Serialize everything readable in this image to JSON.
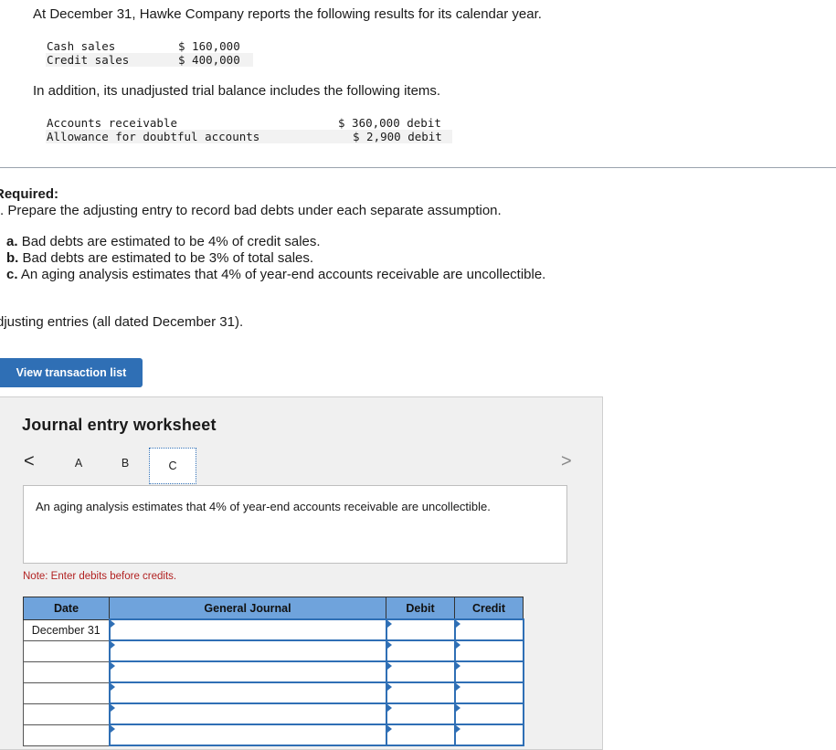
{
  "intro": "At December 31, Hawke Company reports the following results for its calendar year.",
  "sales": [
    {
      "label": "Cash sales",
      "value": "$ 160,000"
    },
    {
      "label": "Credit sales",
      "value": "$ 400,000"
    }
  ],
  "addition_text": "In addition, its unadjusted trial balance includes the following items.",
  "trial_balance": [
    {
      "label": "Accounts receivable",
      "value": "$ 360,000 debit"
    },
    {
      "label": "Allowance for doubtful accounts",
      "value": "$ 2,900 debit"
    }
  ],
  "required_heading": "Required:",
  "required_text": ". Prepare the adjusting entry to record bad debts under each separate assumption.",
  "parts": [
    {
      "letter": "a.",
      "text": "Bad debts are estimated to be 4% of credit sales."
    },
    {
      "letter": "b.",
      "text": "Bad debts are estimated to be 3% of total sales."
    },
    {
      "letter": "c.",
      "text": "An aging analysis estimates that 4% of year-end accounts receivable are uncollectible."
    }
  ],
  "adjusting_text": "djusting entries (all dated December 31).",
  "view_button": "View transaction list",
  "worksheet": {
    "title": "Journal entry worksheet",
    "prev": "<",
    "next": ">",
    "tabs": [
      "A",
      "B",
      "C"
    ],
    "selected_tab": "C",
    "description": "An aging analysis estimates that 4% of year-end accounts receivable are uncollectible.",
    "note": "Note: Enter debits before credits.",
    "headers": {
      "date": "Date",
      "journal": "General Journal",
      "debit": "Debit",
      "credit": "Credit"
    },
    "rows": [
      {
        "date": "December 31"
      },
      {
        "date": ""
      },
      {
        "date": ""
      },
      {
        "date": ""
      },
      {
        "date": ""
      },
      {
        "date": ""
      }
    ]
  }
}
